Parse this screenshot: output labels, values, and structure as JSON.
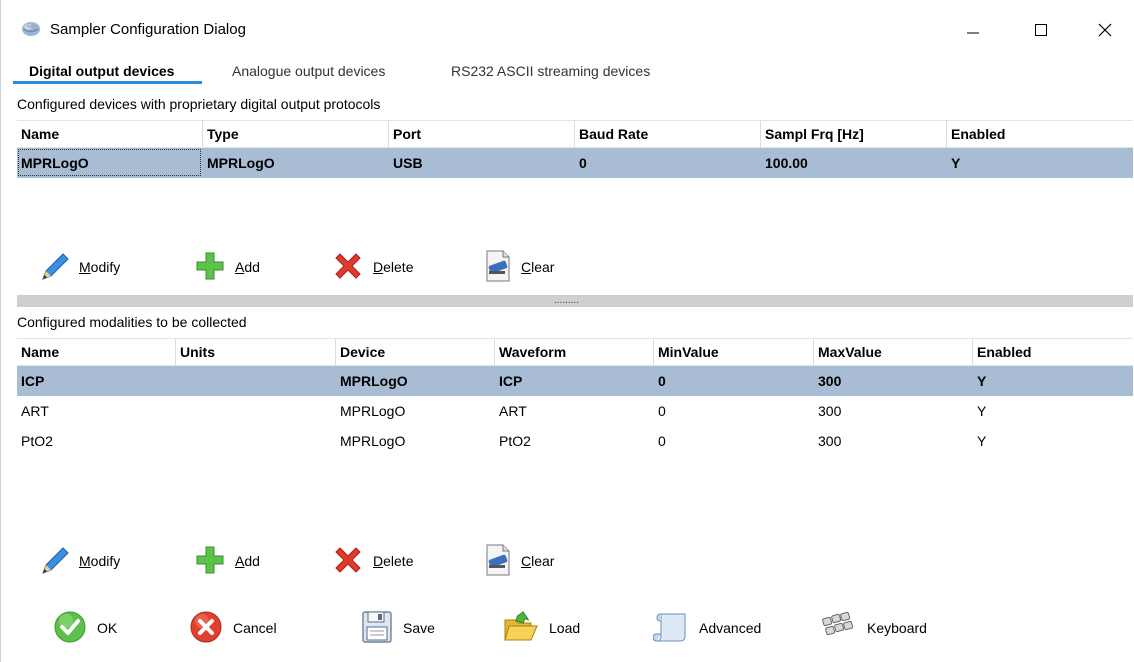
{
  "window": {
    "title": "Sampler Configuration Dialog"
  },
  "tabs": [
    {
      "label": "Digital output devices",
      "active": true
    },
    {
      "label": "Analogue output devices",
      "active": false
    },
    {
      "label": "RS232 ASCII streaming devices",
      "active": false
    }
  ],
  "devices": {
    "section_label": "Configured devices with proprietary digital output protocols",
    "columns": [
      "Name",
      "Type",
      "Port",
      "Baud Rate",
      "Sampl Frq [Hz]",
      "Enabled"
    ],
    "rows": [
      [
        "MPRLogO",
        "MPRLogO",
        "USB",
        "0",
        "100.00",
        "Y"
      ]
    ],
    "buttons": [
      {
        "key": "M",
        "rest": "odify",
        "icon": "pencil-icon"
      },
      {
        "key": "A",
        "rest": "dd",
        "icon": "plus-icon"
      },
      {
        "key": "D",
        "rest": "elete",
        "icon": "delete-x-icon"
      },
      {
        "key": "C",
        "rest": "lear",
        "icon": "eraser-icon"
      }
    ]
  },
  "splitter": {
    "grip": "........."
  },
  "modalities": {
    "section_label": "Configured modalities to be collected",
    "columns": [
      "Name",
      "Units",
      "Device",
      "Waveform",
      "MinValue",
      "MaxValue",
      "Enabled"
    ],
    "rows": [
      [
        "ICP",
        "",
        "MPRLogO",
        "ICP",
        "0",
        "300",
        "Y"
      ],
      [
        "ART",
        "",
        "MPRLogO",
        "ART",
        "0",
        "300",
        "Y"
      ],
      [
        "PtO2",
        "",
        "MPRLogO",
        "PtO2",
        "0",
        "300",
        "Y"
      ]
    ],
    "buttons": [
      {
        "key": "M",
        "rest": "odify",
        "icon": "pencil-icon"
      },
      {
        "key": "A",
        "rest": "dd",
        "icon": "plus-icon"
      },
      {
        "key": "D",
        "rest": "elete",
        "icon": "delete-x-icon"
      },
      {
        "key": "C",
        "rest": "lear",
        "icon": "eraser-icon"
      }
    ]
  },
  "footer": {
    "ok": "OK",
    "cancel": "Cancel",
    "save": "Save",
    "load": "Load",
    "advanced": "Advanced",
    "keyboard": "Keyboard"
  },
  "colors": {
    "selection": "#a8bdd4",
    "tab_underline": "#2b8bd7"
  }
}
